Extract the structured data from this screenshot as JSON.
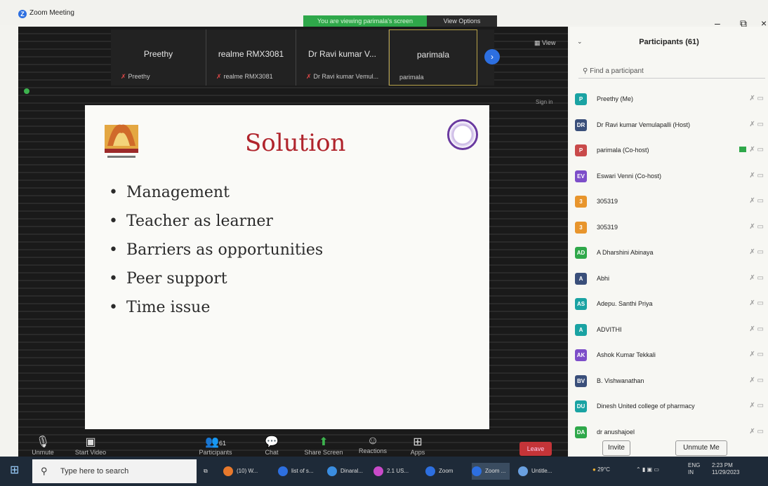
{
  "window": {
    "title": "Zoom Meeting",
    "banner": "You are viewing parimala's screen",
    "view_options": "View Options",
    "minimize": "–",
    "restore": "⧉",
    "close": "×"
  },
  "meeting": {
    "view_label": "View",
    "sign_in": "Sign in",
    "tiles": [
      {
        "name": "Preethy",
        "sub": "Preethy"
      },
      {
        "name": "realme RMX3081",
        "sub": "realme RMX3081"
      },
      {
        "name": "Dr Ravi kumar V...",
        "sub": "Dr Ravi kumar Vemul..."
      },
      {
        "name": "parimala",
        "sub": "parimala"
      }
    ]
  },
  "slide": {
    "title": "Solution",
    "bullets": [
      "Management",
      "Teacher as learner",
      "Barriers as opportunities",
      "Peer support",
      "Time issue"
    ]
  },
  "controls": {
    "unmute": "Unmute",
    "start_video": "Start Video",
    "participants": "Participants",
    "participants_count": "61",
    "chat": "Chat",
    "share_screen": "Share Screen",
    "reactions": "Reactions",
    "apps": "Apps",
    "leave": "Leave"
  },
  "panel": {
    "title": "Participants (61)",
    "search_placeholder": "Find a participant",
    "participants": [
      {
        "initials": "P",
        "name": "Preethy (Me)",
        "color": "#1aa3a3"
      },
      {
        "initials": "DR",
        "name": "Dr Ravi kumar Vemulapalli (Host)",
        "color": "#3a4f7a"
      },
      {
        "initials": "P",
        "name": "parimala (Co-host)",
        "color": "#c94a4a"
      },
      {
        "initials": "EV",
        "name": "Eswari Venni (Co-host)",
        "color": "#7d4ec9"
      },
      {
        "initials": "3",
        "name": "305319",
        "color": "#e8952c"
      },
      {
        "initials": "3",
        "name": "305319",
        "color": "#e8952c"
      },
      {
        "initials": "AD",
        "name": "A Dharshini Abinaya",
        "color": "#2fa84a"
      },
      {
        "initials": "A",
        "name": "Abhi",
        "color": "#3a4f7a"
      },
      {
        "initials": "AS",
        "name": "Adepu. Santhi Priya",
        "color": "#1aa3a3"
      },
      {
        "initials": "A",
        "name": "ADVITHI",
        "color": "#1aa3a3"
      },
      {
        "initials": "AK",
        "name": "Ashok Kumar Tekkali",
        "color": "#7d4ec9"
      },
      {
        "initials": "BV",
        "name": "B. Vishwanathan",
        "color": "#3a4f7a"
      },
      {
        "initials": "DU",
        "name": "Dinesh United college of pharmacy",
        "color": "#1aa3a3"
      },
      {
        "initials": "DA",
        "name": "dr anushajoel",
        "color": "#2fa84a"
      }
    ],
    "invite": "Invite",
    "unmute_me": "Unmute Me"
  },
  "taskbar": {
    "search_placeholder": "Type here to search",
    "apps": [
      {
        "label": "(10) W...",
        "color": "#e8792c"
      },
      {
        "label": "list of s...",
        "color": "#2d6fe0"
      },
      {
        "label": "Dinaral...",
        "color": "#3a8de0"
      },
      {
        "label": "2.1 US...",
        "color": "#c94ac9"
      },
      {
        "label": "Zoom",
        "color": "#2d6fe0"
      },
      {
        "label": "Zoom ...",
        "color": "#2d6fe0"
      },
      {
        "label": "Untitle...",
        "color": "#6aa0e0"
      }
    ],
    "weather": "29°C",
    "lang": "ENG IN",
    "time": "2:23 PM",
    "date": "11/29/2023"
  }
}
